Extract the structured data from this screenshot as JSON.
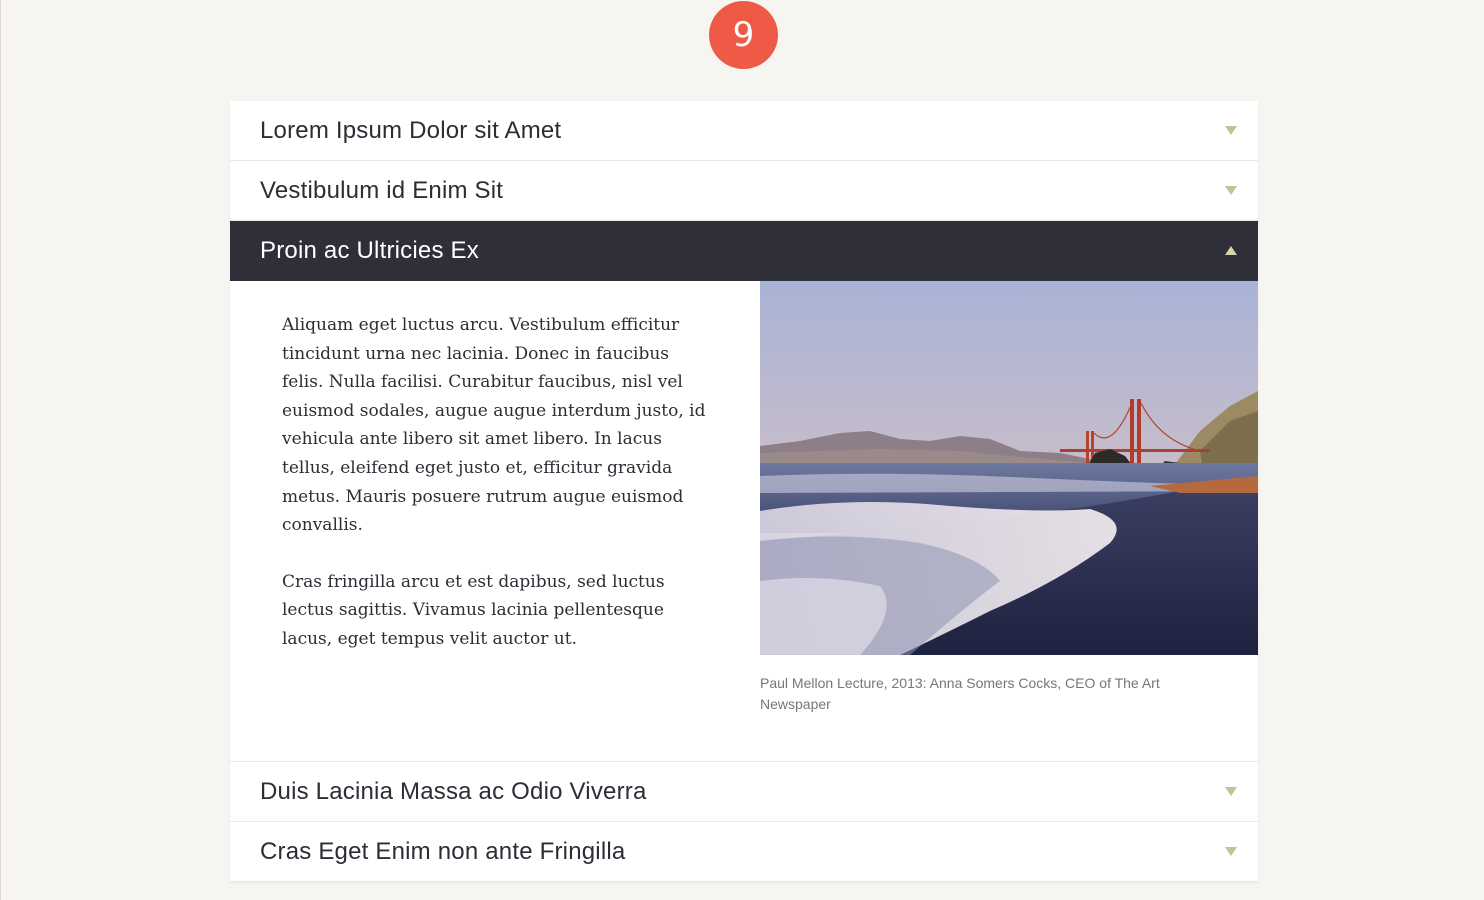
{
  "step_number": "9",
  "accordion": {
    "items": [
      {
        "title": "Lorem Ipsum Dolor sit Amet",
        "open": false
      },
      {
        "title": "Vestibulum id Enim Sit",
        "open": false
      },
      {
        "title": "Proin ac Ultricies Ex",
        "open": true
      },
      {
        "title": "Duis Lacinia Massa ac Odio Viverra",
        "open": false
      },
      {
        "title": "Cras Eget Enim non ante Fringilla",
        "open": false
      }
    ],
    "open_panel": {
      "paragraphs": [
        "Aliquam eget luctus arcu. Vestibulum efficitur tincidunt urna nec lacinia. Donec in faucibus felis. Nulla facilisi. Curabitur faucibus, nisl vel euismod sodales, augue augue interdum justo, id vehicula ante libero sit amet libero. In lacus tellus, eleifend eget justo et, efficitur gravida metus. Mauris posuere rutrum augue euismod convallis.",
        "Cras fringilla arcu et est dapibus, sed luctus lectus sagittis. Vivamus lacinia pellentesque lacus, eget tempus velit auctor ut."
      ],
      "image_caption": "Paul Mellon Lecture, 2013: Anna Somers Cocks, CEO of The Art Newspaper"
    }
  },
  "colors": {
    "badge": "#ef5a46",
    "active_header": "#2e2f38",
    "caret": "#c7bf97",
    "page_background": "#f6f5f1"
  }
}
